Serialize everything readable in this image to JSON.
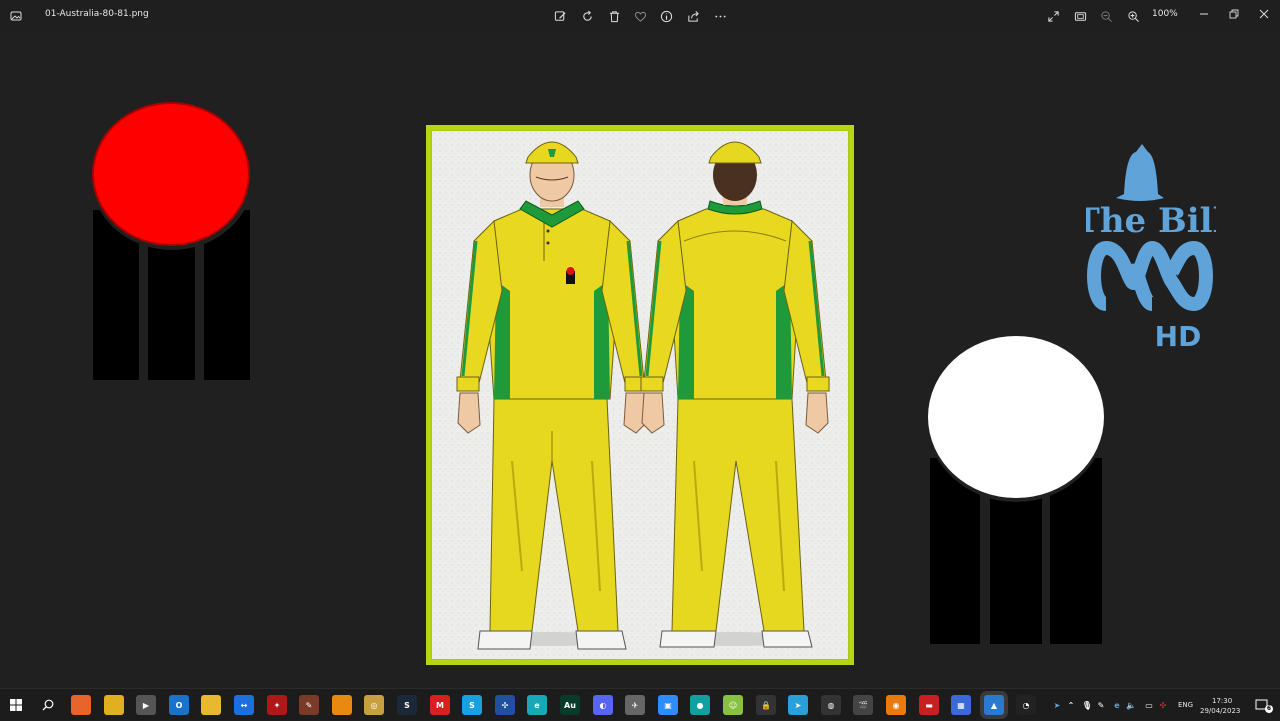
{
  "titlebar": {
    "file_name": "01-Australia-80-81.png",
    "zoom": "100%",
    "tools": [
      "edit-image-icon",
      "rotate-icon",
      "delete-icon",
      "favorite-icon",
      "info-icon",
      "share-icon",
      "more-icon"
    ],
    "right_tools": [
      "expand-icon",
      "fit-icon",
      "zoom-out-icon",
      "zoom-in-icon"
    ]
  },
  "canvas": {
    "left_wicket": {
      "ball_color": "#ff0000"
    },
    "right_wicket": {
      "ball_color": "#ffffff"
    },
    "logo": {
      "line1": "The Bill",
      "line2": "HD",
      "color": "#5fa3d8"
    },
    "kit": {
      "shirt_color": "#e8d820",
      "trim_color": "#1f9a3a"
    }
  },
  "taskbar": {
    "apps": [
      {
        "name": "firefox-icon",
        "color": "#e8642b",
        "glyph": ""
      },
      {
        "name": "chrome-icon",
        "color": "#e0b020",
        "glyph": ""
      },
      {
        "name": "media-player-icon",
        "color": "#555555",
        "glyph": "▶"
      },
      {
        "name": "outlook-icon",
        "color": "#1a73c8",
        "glyph": "O"
      },
      {
        "name": "file-explorer-icon",
        "color": "#e8b830",
        "glyph": ""
      },
      {
        "name": "teamviewer-icon",
        "color": "#1d6fe0",
        "glyph": "↔"
      },
      {
        "name": "bird-app-icon",
        "color": "#b01818",
        "glyph": "✦"
      },
      {
        "name": "brush-app-icon",
        "color": "#7a3a28",
        "glyph": "✎"
      },
      {
        "name": "vlc-icon",
        "color": "#e88a10",
        "glyph": ""
      },
      {
        "name": "sports-app-icon",
        "color": "#c8a040",
        "glyph": "◎"
      },
      {
        "name": "steam-icon",
        "color": "#1b2838",
        "glyph": "S"
      },
      {
        "name": "mega-icon",
        "color": "#d82020",
        "glyph": "M"
      },
      {
        "name": "skype-icon",
        "color": "#18a0e0",
        "glyph": "S"
      },
      {
        "name": "network-app-icon",
        "color": "#2050a0",
        "glyph": "✣"
      },
      {
        "name": "edge-icon",
        "color": "#18a8b8",
        "glyph": "e"
      },
      {
        "name": "audition-icon",
        "color": "#0a3a2a",
        "glyph": "Au"
      },
      {
        "name": "discord-icon",
        "color": "#5865f2",
        "glyph": "◐"
      },
      {
        "name": "plane-app-icon",
        "color": "#666666",
        "glyph": "✈"
      },
      {
        "name": "zoom-icon",
        "color": "#2d8cff",
        "glyph": "▣"
      },
      {
        "name": "globe-app-icon",
        "color": "#10a0a0",
        "glyph": "●"
      },
      {
        "name": "android-app-icon",
        "color": "#8ac040",
        "glyph": "☺"
      },
      {
        "name": "vpn-app-icon",
        "color": "#333333",
        "glyph": "🔒"
      },
      {
        "name": "telegram-icon",
        "color": "#2aa0d8",
        "glyph": "➤"
      },
      {
        "name": "browser-app-icon",
        "color": "#333333",
        "glyph": "◍"
      },
      {
        "name": "video-app-icon",
        "color": "#444444",
        "glyph": "🎬"
      },
      {
        "name": "blender-icon",
        "color": "#e87a10",
        "glyph": "◉"
      },
      {
        "name": "red-app-icon",
        "color": "#c82020",
        "glyph": "▬"
      },
      {
        "name": "store-icon",
        "color": "#3a6ad8",
        "glyph": "▦"
      },
      {
        "name": "photos-icon",
        "color": "#2a7ad0",
        "glyph": "▲"
      },
      {
        "name": "cricket-app-icon",
        "color": "#222222",
        "glyph": "◔"
      }
    ],
    "language": "ENG",
    "time": "17:30",
    "date": "29/04/2023",
    "notification_count": "6"
  }
}
